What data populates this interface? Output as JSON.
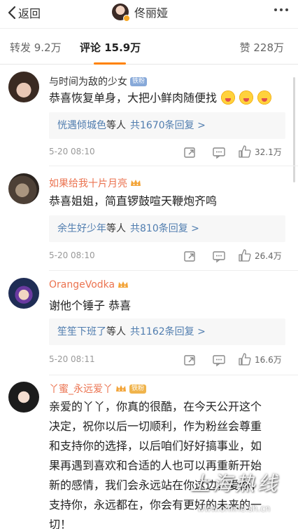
{
  "header": {
    "back_label": "返回",
    "title": "佟丽娅"
  },
  "tabs": {
    "repost": "转发 9.2万",
    "comment": "评论 15.9万",
    "like": "赞 228万"
  },
  "comments": [
    {
      "user": "与时间为敌的少女",
      "badge": "铁粉",
      "text": "恭喜恢复单身，大把小鲜肉随便找",
      "emoji_count": 3,
      "reply_from": "恍遇倾城色",
      "reply_etc": "等人",
      "reply_count": "共1670条回复 >",
      "time": "5-20 08:10",
      "likes": "32.1万"
    },
    {
      "user": "如果给我十片月亮",
      "text": "恭喜姐姐，简直锣鼓喧天鞭炮齐鸣",
      "reply_from": "余生好少年",
      "reply_etc": "等人",
      "reply_count": "共810条回复 >",
      "time": "5-20 08:10",
      "likes": "26.4万"
    },
    {
      "user": "OrangeVodka",
      "text": "谢他个锤子 恭喜",
      "reply_from": "笙笙下班了",
      "reply_etc": "等人",
      "reply_count": "共1162条回复 >",
      "time": "5-20 08:11",
      "likes": "16.6万"
    },
    {
      "user": "丫蜜_永远爱丫",
      "badge": "铁粉",
      "text_lines": [
        "亲爱的丫丫，你真的很酷，在今天公开这个",
        "决定，祝你以后一切顺利，作为粉丝会尊重",
        "和支持你的选择，以后咱们好好搞事业，如",
        "果再遇到喜欢和合适的人也可以再重新开始",
        "新的感情，我们会永远站在你这边，爱你，",
        "支持你，永远都在，你会有更好的未来的一",
        "切！"
      ]
    }
  ],
  "watermark": {
    "title": "上海热线",
    "url": "www.online.sh.cn"
  },
  "colors": {
    "accent": "#ff8200",
    "link": "#507daf",
    "username_orange": "#eb7350"
  }
}
